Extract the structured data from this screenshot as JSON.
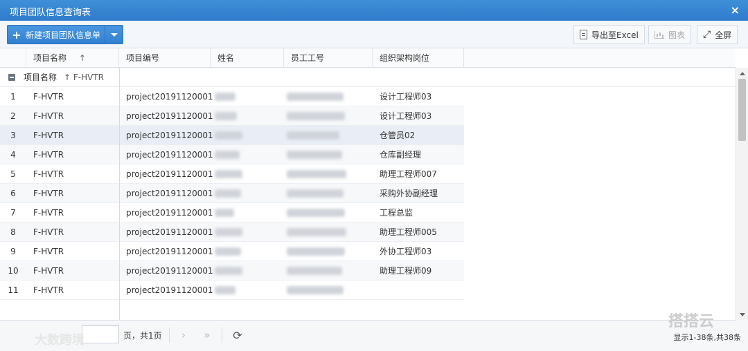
{
  "window": {
    "title": "项目团队信息查询表",
    "close_icon": "×"
  },
  "toolbar": {
    "new_label": "新建项目团队信息单",
    "export_label": "导出至Excel",
    "chart_label": "图表",
    "fullscreen_label": "全屏"
  },
  "columns": {
    "project_name": "项目名称",
    "project_name_sort": "↑",
    "project_code": "项目编号",
    "name": "姓名",
    "employee_no": "员工工号",
    "org_post": "组织架构岗位"
  },
  "group": {
    "label": "项目名称",
    "value": "↑ F-HVTR"
  },
  "rows": [
    {
      "idx": "1",
      "project": "F-HVTR",
      "code": "project20191120001",
      "post": "设计工程师03"
    },
    {
      "idx": "2",
      "project": "F-HVTR",
      "code": "project20191120001",
      "post": "设计工程师03"
    },
    {
      "idx": "3",
      "project": "F-HVTR",
      "code": "project20191120001",
      "post": "仓管员02"
    },
    {
      "idx": "4",
      "project": "F-HVTR",
      "code": "project20191120001",
      "post": "仓库副经理"
    },
    {
      "idx": "5",
      "project": "F-HVTR",
      "code": "project20191120001",
      "post": "助理工程师007"
    },
    {
      "idx": "6",
      "project": "F-HVTR",
      "code": "project20191120001",
      "post": "采购外协副经理"
    },
    {
      "idx": "7",
      "project": "F-HVTR",
      "code": "project20191120001",
      "post": "工程总监"
    },
    {
      "idx": "8",
      "project": "F-HVTR",
      "code": "project20191120001",
      "post": "助理工程师005"
    },
    {
      "idx": "9",
      "project": "F-HVTR",
      "code": "project20191120001",
      "post": "外协工程师03"
    },
    {
      "idx": "10",
      "project": "F-HVTR",
      "code": "project20191120001",
      "post": "助理工程师09"
    },
    {
      "idx": "11",
      "project": "F-HVTR",
      "code": "project20191120001",
      "post": ""
    }
  ],
  "pager": {
    "page_text": "页，共1页",
    "info": "显示1-38条,共38条",
    "next": "›",
    "last": "»",
    "refresh": "⟳"
  },
  "watermarks": {
    "left": "大数跨境",
    "right": "搭搭云"
  }
}
